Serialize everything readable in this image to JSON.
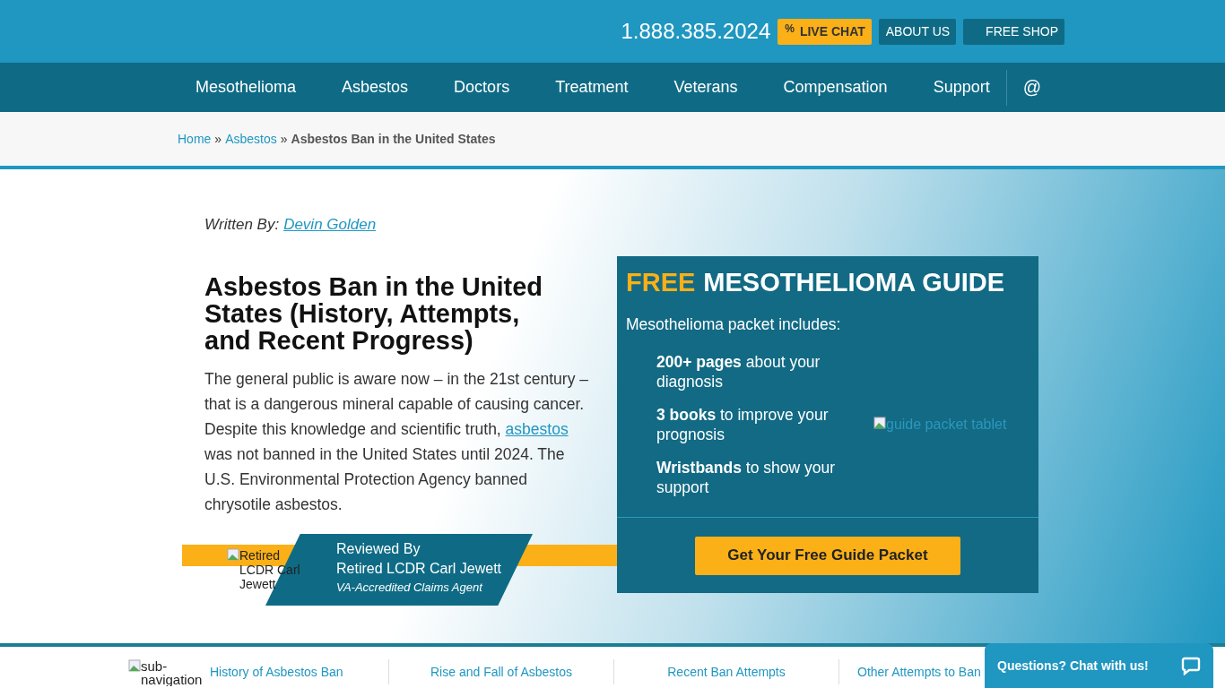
{
  "topbar": {
    "phone": "1.888.385.2024",
    "buttons": [
      {
        "kind": "chat",
        "icon": "%",
        "label": "LIVE CHAT"
      },
      {
        "kind": "plain",
        "label": "ABOUT US"
      },
      {
        "kind": "shop",
        "label": "FREE SHOP"
      }
    ]
  },
  "nav": {
    "items": [
      "Mesothelioma",
      "Asbestos",
      "Doctors",
      "Treatment",
      "Veterans",
      "Compensation",
      "Support"
    ],
    "icon": "@"
  },
  "breadcrumb": [
    {
      "label": "Home",
      "link": true
    },
    {
      "label": "Asbestos",
      "link": true
    },
    {
      "label": "Asbestos Ban in the United States",
      "link": false
    }
  ],
  "breadcrumb_separator": "»",
  "byline": {
    "label": "Written By:",
    "author": "Devin Golden"
  },
  "article": {
    "title": "Asbestos Ban in the United States (History, Attempts, and Recent Progress)",
    "before_link": "The general public is aware now – in the 21st century – that is a dangerous mineral capable of causing cancer. Despite this knowledge and scientific truth,",
    "link": "asbestos",
    "after_link": "was not banned in the United States until 2024. The U.S. Environmental Protection Agency banned chrysotile asbestos."
  },
  "reviewer": {
    "image_alt": "Retired LCDR Carl Jewett",
    "label": "Reviewed By",
    "name": "Retired LCDR Carl Jewett",
    "role": "VA-Accredited Claims Agent"
  },
  "guide": {
    "title_highlight": "FREE",
    "title": "MESOTHELIOMA GUIDE",
    "intro": "Mesothelioma packet includes:",
    "items": [
      "**200+ pages** about your diagnosis",
      "**3 books** to improve your prognosis",
      "**Wristbands** to show your support"
    ],
    "image_alt": "guide packet tablet",
    "button": "Get Your Free Guide Packet"
  },
  "subnav": {
    "image_alt": "sub-navigation",
    "items": [
      "History of Asbestos Ban",
      "Rise and Fall of Asbestos",
      "Recent Ban Attempts",
      "Other Attempts to Ban"
    ]
  },
  "chat_widget": {
    "label": "Questions? Chat with us!"
  }
}
